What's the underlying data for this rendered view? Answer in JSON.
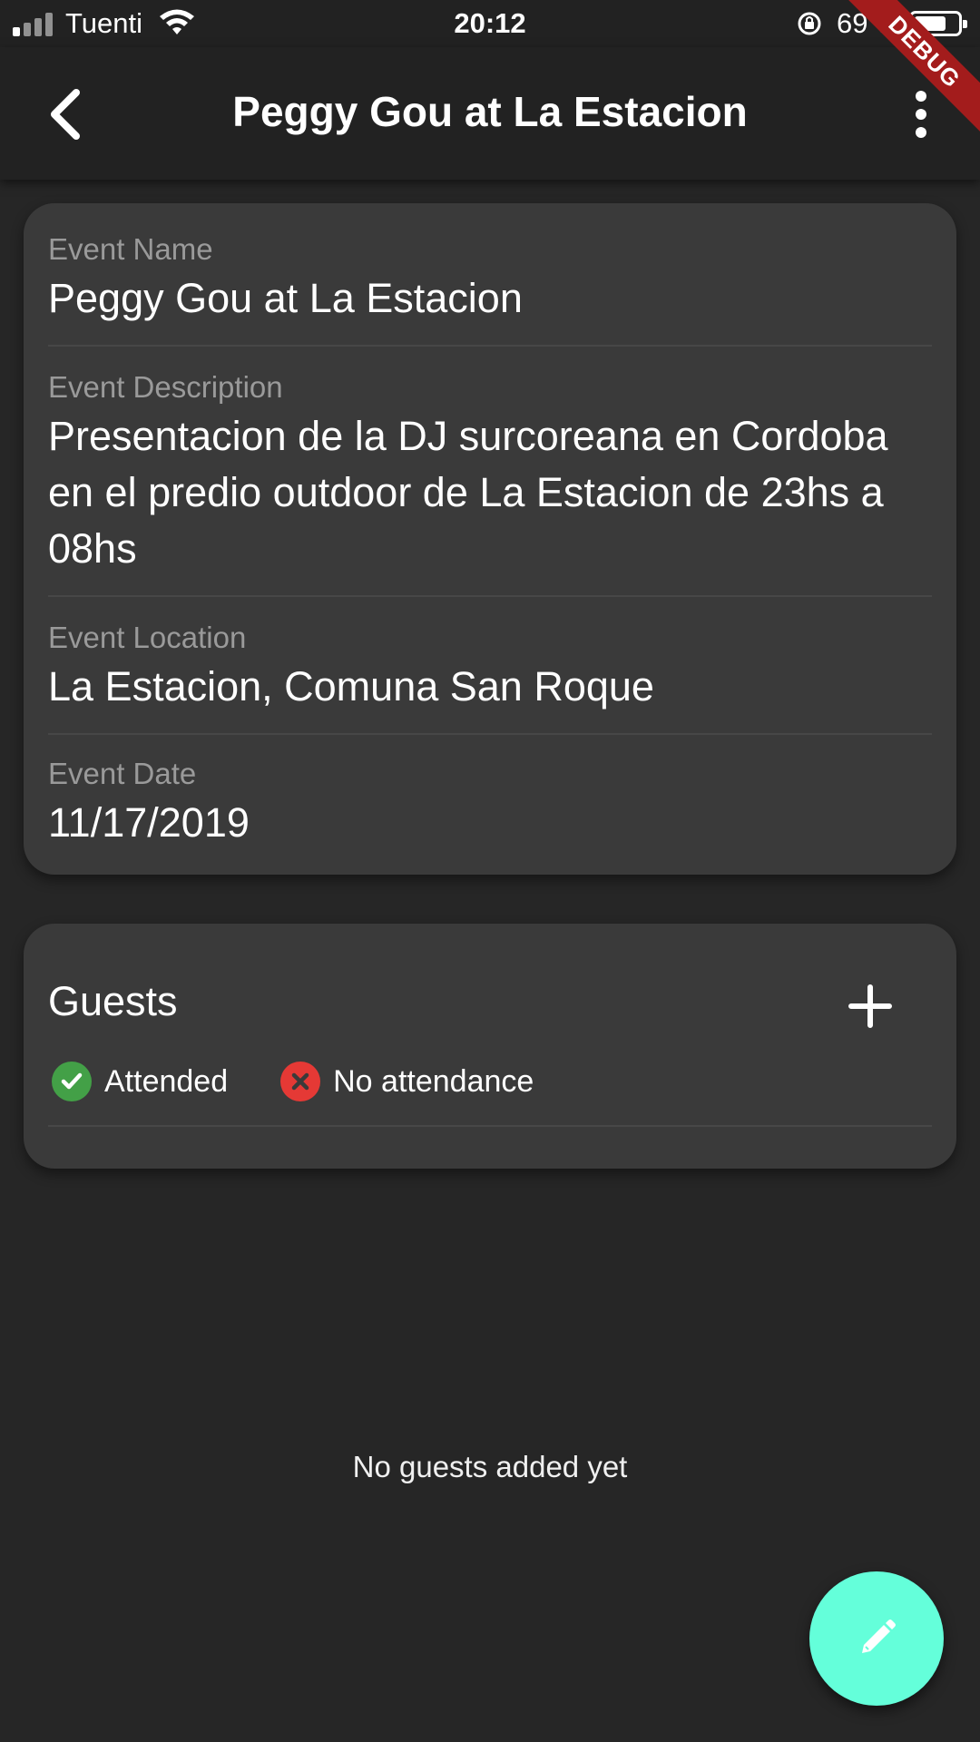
{
  "status_bar": {
    "carrier": "Tuenti",
    "time": "20:12",
    "battery_percent": "69 %",
    "debug_label": "DEBUG"
  },
  "app_bar": {
    "title": "Peggy Gou at La Estacion",
    "back_icon": "chevron-left-icon",
    "menu_icon": "more-vertical-icon"
  },
  "event": {
    "name_label": "Event Name",
    "name": "Peggy Gou at La Estacion",
    "description_label": "Event Description",
    "description": "Presentacion de la DJ surcoreana en Cordoba en el predio outdoor de La Estacion de 23hs a 08hs",
    "location_label": "Event Location",
    "location": "La Estacion, Comuna San Roque",
    "date_label": "Event Date",
    "date": "11/17/2019"
  },
  "guests": {
    "title": "Guests",
    "add_icon": "plus-icon",
    "legend": [
      {
        "label": "Attended",
        "icon": "check-circle-icon",
        "color": "#43a047"
      },
      {
        "label": "No attendance",
        "icon": "x-circle-icon",
        "color": "#e53935"
      }
    ],
    "empty_message": "No guests added yet"
  },
  "fab": {
    "icon": "pencil-icon",
    "color": "#64ffda"
  }
}
